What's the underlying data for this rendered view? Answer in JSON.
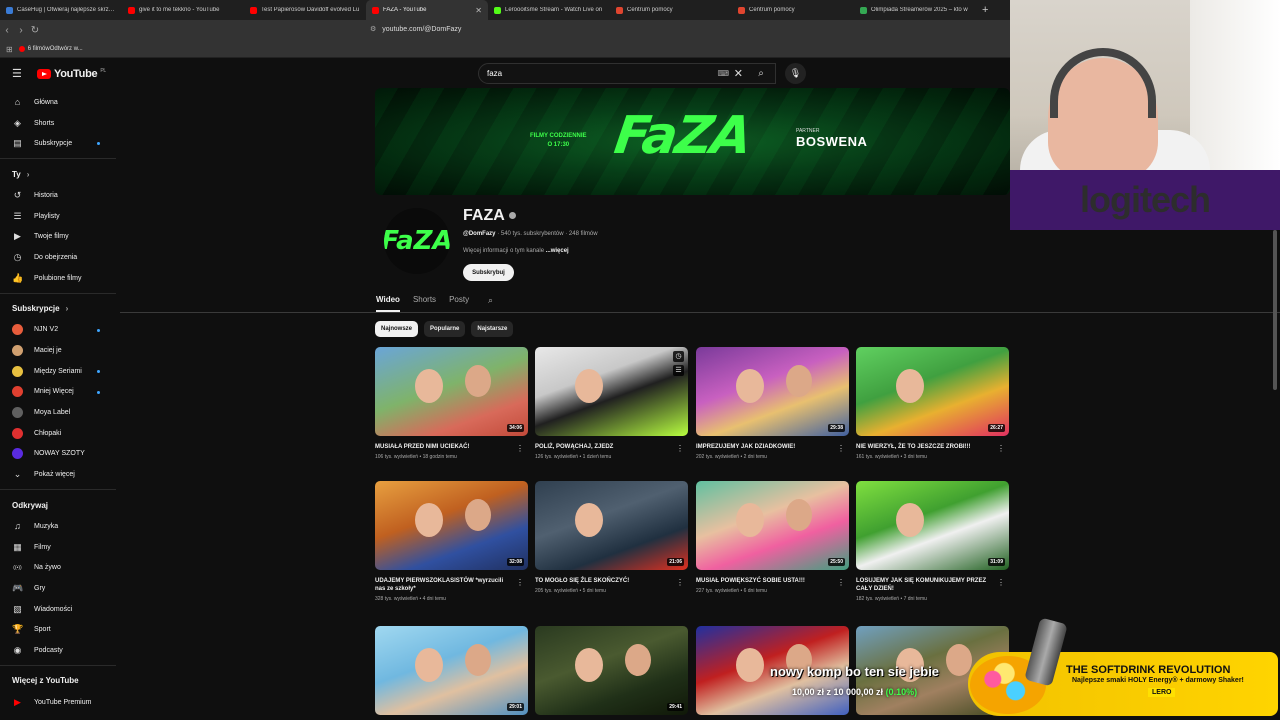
{
  "browser": {
    "tabs": [
      {
        "label": "CaseHug | Otwieraj najlepsze skrzynki",
        "color": "#3a7bd5",
        "active": false
      },
      {
        "label": "give it to me tekkno - YouTube",
        "color": "#ff0000",
        "active": false
      },
      {
        "label": "Test Papierosów Davidoff evolved Lu",
        "color": "#ff0000",
        "active": false
      },
      {
        "label": "FAZA - YouTube",
        "color": "#ff0000",
        "active": true
      },
      {
        "label": "Leroooitsme Stream - Watch Live on",
        "color": "#53fc18",
        "active": false
      },
      {
        "label": "Centrum pomocy",
        "color": "#e0452f",
        "active": false
      },
      {
        "label": "Centrum pomocy",
        "color": "#e0452f",
        "active": false
      },
      {
        "label": "Olimpiada Streamerów 2025 – kto w",
        "color": "#34a853",
        "active": false
      }
    ],
    "url": "youtube.com/@DomFazy",
    "bookmark": "6 filmówOdtwórz w..."
  },
  "header": {
    "logo": "YouTube",
    "region": "PL",
    "search_value": "faza"
  },
  "sidebar": {
    "main": [
      {
        "label": "Główna",
        "icon": "home-icon",
        "glyph": "⌂"
      },
      {
        "label": "Shorts",
        "icon": "shorts-icon",
        "glyph": "◈"
      },
      {
        "label": "Subskrypcje",
        "icon": "subscriptions-icon",
        "glyph": "▤",
        "dot": true
      }
    ],
    "you_heading": "Ty",
    "you": [
      {
        "label": "Historia",
        "icon": "history-icon",
        "glyph": "↺"
      },
      {
        "label": "Playlisty",
        "icon": "playlists-icon",
        "glyph": "☰"
      },
      {
        "label": "Twoje filmy",
        "icon": "your-videos-icon",
        "glyph": "▶"
      },
      {
        "label": "Do obejrzenia",
        "icon": "watch-later-icon",
        "glyph": "◷"
      },
      {
        "label": "Polubione filmy",
        "icon": "liked-icon",
        "glyph": "👍"
      }
    ],
    "subs_heading": "Subskrypcje",
    "subs": [
      {
        "label": "NJN V2",
        "color": "#e85d3c",
        "dot": true
      },
      {
        "label": "Maciej je",
        "color": "#d0a070",
        "dot": false
      },
      {
        "label": "Między Seriami",
        "color": "#e8c040",
        "dot": true
      },
      {
        "label": "Mniej Więcej",
        "color": "#e04030",
        "dot": true
      },
      {
        "label": "Moya Label",
        "color": "#606060",
        "dot": false
      },
      {
        "label": "Chłopaki",
        "color": "#e03030",
        "dot": false
      },
      {
        "label": "NOWAY SZOTY",
        "color": "#5a2be0",
        "dot": false
      }
    ],
    "show_more": "Pokaż więcej",
    "explore_heading": "Odkrywaj",
    "explore": [
      {
        "label": "Muzyka",
        "icon": "music-icon",
        "glyph": "♫"
      },
      {
        "label": "Filmy",
        "icon": "movies-icon",
        "glyph": "▦"
      },
      {
        "label": "Na żywo",
        "icon": "live-icon",
        "glyph": "((•))"
      },
      {
        "label": "Gry",
        "icon": "gaming-icon",
        "glyph": "🎮"
      },
      {
        "label": "Wiadomości",
        "icon": "news-icon",
        "glyph": "▧"
      },
      {
        "label": "Sport",
        "icon": "sport-icon",
        "glyph": "🏆"
      },
      {
        "label": "Podcasty",
        "icon": "podcasts-icon",
        "glyph": "◉"
      }
    ],
    "more_heading": "Więcej z YouTube",
    "more": [
      {
        "label": "YouTube Premium",
        "color": "#ff0000"
      }
    ]
  },
  "banner": {
    "daily_line1": "FILMY CODZIENNIE",
    "daily_line2": "O 17:30",
    "logo": "FaZA",
    "partner": "PARTNER",
    "sponsor": "BOSWENA"
  },
  "channel": {
    "avatar_text": "FaZA",
    "name": "FAZA",
    "handle": "@DomFazy",
    "stats": " · 540 tys. subskrybentów · 248 filmów",
    "more_info": "Więcej informacji o tym kanale",
    "more_link": " ...więcej",
    "subscribe": "Subskrybuj"
  },
  "tabs": [
    "Wideo",
    "Shorts",
    "Posty"
  ],
  "chips": [
    "Najnowsze",
    "Popularne",
    "Najstarsze"
  ],
  "videos": [
    {
      "title": "MUSIAŁA PRZED NIMI UCIEKAĆ!",
      "meta": "106 tys. wyświetleń • 18 godzin temu",
      "duration": "34:06",
      "bg": "linear-gradient(160deg,#6aa5d8 0%,#7fb36a 45%,#d86a5a 75%,#c24a3a 100%)"
    },
    {
      "title": "POLIŻ, POWĄCHAJ, ZJEDZ",
      "meta": "126 tys. wyświetleń • 1 dzień temu",
      "duration": "",
      "bg": "linear-gradient(160deg,#e8e8e8 0%,#c8c8c8 35%,#202020 55%,#b8ff40 100%)"
    },
    {
      "title": "IMPREZUJEMY JAK DZIADKOWIE!",
      "meta": "202 tys. wyświetleń • 2 dni temu",
      "duration": "29:38",
      "bg": "linear-gradient(160deg,#7a3a9a 0%,#c860c0 40%,#e8c070 65%,#4060a0 100%)"
    },
    {
      "title": "NIE WIERZYŁ, ŻE TO JESZCZE ZROBI!!!",
      "meta": "161 tys. wyświetleń • 3 dni temu",
      "duration": "26:27",
      "bg": "linear-gradient(160deg,#60d060 0%,#40a040 40%,#e8b030 65%,#e03060 100%)"
    },
    {
      "title": "UDAJEMY PIERWSZOKLASISTÓW *wyrzucili nas ze szkoły*",
      "meta": "328 tys. wyświetleń • 4 dni temu",
      "duration": "32:08",
      "bg": "linear-gradient(160deg,#e8a040 0%,#c06020 40%,#3050a0 70%,#203060 100%)"
    },
    {
      "title": "TO MOGŁO SIĘ ŹLE SKOŃCZYĆ!",
      "meta": "205 tys. wyświetleń • 5 dni temu",
      "duration": "21:06",
      "bg": "linear-gradient(160deg,#304050 0%,#506070 40%,#203040 70%,#e03020 100%)"
    },
    {
      "title": "MUSIAŁ POWIĘKSZYĆ SOBIE USTA!!!",
      "meta": "227 tys. wyświetleń • 6 dni temu",
      "duration": "25:50",
      "bg": "linear-gradient(160deg,#60c0a0 0%,#e8c0a0 40%,#f060a0 65%,#40a080 100%)"
    },
    {
      "title": "LOSUJEMY JAK SIĘ KOMUNIKUJEMY PRZEZ CAŁY DZIEŃ!",
      "meta": "182 tys. wyświetleń • 7 dni temu",
      "duration": "31:09",
      "bg": "linear-gradient(160deg,#80e040 0%,#40a030 40%,#f0f0f0 60%,#206020 100%)"
    },
    {
      "title": "",
      "meta": "",
      "duration": "29:01",
      "bg": "linear-gradient(160deg,#a0d8f0 0%,#70b8e0 40%,#e0c0a0 65%,#5090c0 100%)"
    },
    {
      "title": "",
      "meta": "",
      "duration": "29:41",
      "bg": "linear-gradient(160deg,#2a3a20 0%,#4a5a30 40%,#203018 70%,#101808 100%)"
    },
    {
      "title": "",
      "meta": "",
      "duration": "",
      "bg": "linear-gradient(160deg,#2030a0 0%,#c02020 40%,#e0c0a0 65%,#4060c0 100%)"
    },
    {
      "title": "",
      "meta": "",
      "duration": "",
      "bg": "linear-gradient(160deg,#70a0c0 0%,#6a7040 40%,#a08060 65%,#404820 100%)"
    }
  ],
  "overlays": {
    "logitech": "logitech",
    "donation_msg": "nowy komp bo ten sie jebie",
    "donation_amount": "10,00 zł",
    "donation_sep": " z ",
    "donation_goal": "10 000,00 zł",
    "donation_pct": "(0.10%)",
    "promo_h1": "THE SOFTDRINK REVOLUTION",
    "promo_h2": "Najlepsze smaki HOLY Energy® + darmowy Shaker!",
    "promo_h3": "LERO"
  }
}
